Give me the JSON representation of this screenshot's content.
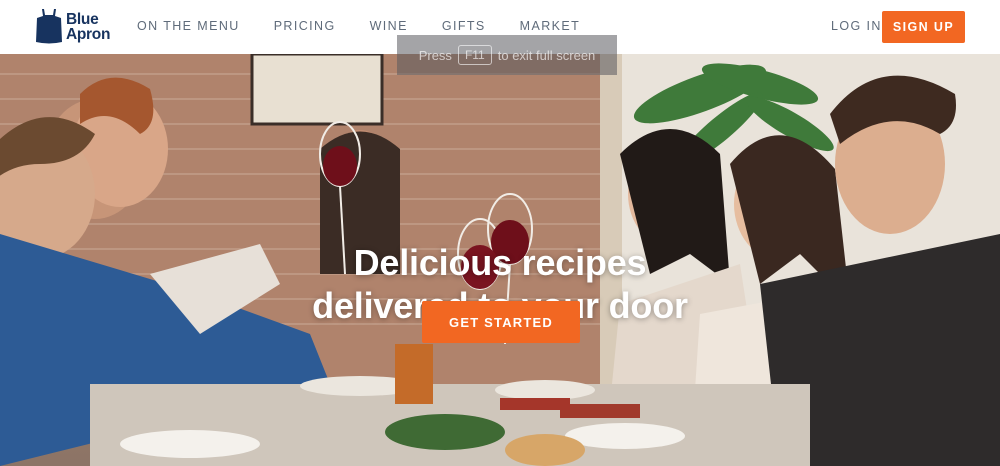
{
  "brand": {
    "name_line1": "Blue",
    "name_line2": "Apron",
    "logo_color": "#17335f"
  },
  "nav": {
    "items": [
      {
        "label": "ON THE MENU"
      },
      {
        "label": "PRICING"
      },
      {
        "label": "WINE"
      },
      {
        "label": "GIFTS"
      },
      {
        "label": "MARKET"
      }
    ],
    "login_label": "LOG IN",
    "signup_label": "SIGN UP"
  },
  "fullscreen_notice": {
    "prefix": "Press",
    "key": "F11",
    "suffix": "to exit full screen"
  },
  "hero": {
    "headline_line1": "Delicious recipes",
    "headline_line2": "delivered to your door",
    "cta_label": "GET STARTED",
    "background_description_icon": "dinner-party-photo"
  },
  "colors": {
    "accent": "#f26722",
    "nav_text": "#5f6b7a"
  }
}
